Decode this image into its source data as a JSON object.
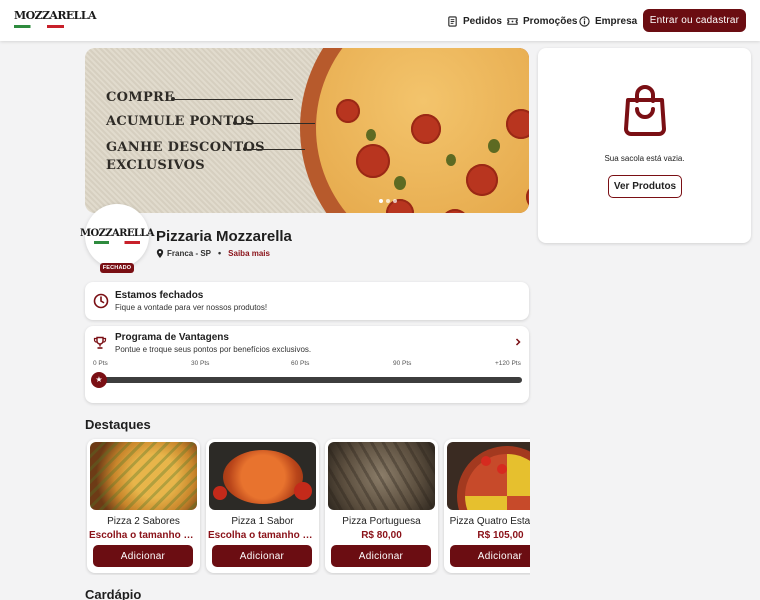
{
  "header": {
    "logo_text": "MOZZARELLA",
    "nav": [
      {
        "label": "Pedidos",
        "icon": "receipt-icon"
      },
      {
        "label": "Promoções",
        "icon": "ticket-icon"
      },
      {
        "label": "Empresa",
        "icon": "info-icon"
      }
    ],
    "login_label": "Entrar ou cadastrar"
  },
  "banner": {
    "lines": [
      "COMPRE",
      "ACUMULE PONTOS",
      "GANHE DESCONTOS",
      "EXCLUSIVOS"
    ],
    "slides": 3,
    "active_slide": 1
  },
  "store": {
    "logo_text": "MOZZARELLA",
    "status_badge": "FECHADO",
    "name": "Pizzaria Mozzarella",
    "location": "Franca - SP",
    "more_link": "Saiba mais"
  },
  "closed_notice": {
    "title": "Estamos fechados",
    "subtitle": "Fique a vontade para ver nossos produtos!"
  },
  "loyalty": {
    "title": "Programa de Vantagens",
    "subtitle": "Pontue e troque seus pontos por benefícios exclusivos.",
    "milestones": [
      "0 Pts",
      "30 Pts",
      "60 Pts",
      "90 Pts",
      "+120 Pts"
    ],
    "progress_fraction": 0
  },
  "bag": {
    "empty_text": "Sua sacola está vazia.",
    "button_label": "Ver Produtos"
  },
  "highlights": {
    "title": "Destaques",
    "products": [
      {
        "name": "Pizza 2 Sabores",
        "price": "Escolha o tamanho e o...",
        "button": "Adicionar"
      },
      {
        "name": "Pizza 1 Sabor",
        "price": "Escolha o tamanho e o...",
        "button": "Adicionar"
      },
      {
        "name": "Pizza Portuguesa",
        "price": "R$ 80,00",
        "button": "Adicionar"
      },
      {
        "name": "Pizza Quatro Estações",
        "price": "R$ 105,00",
        "button": "Adicionar"
      }
    ]
  },
  "menu": {
    "title": "Cardápio"
  },
  "colors": {
    "brand": "#6b0d12",
    "brand_text": "#8a1118",
    "background": "#f3f3f4"
  }
}
